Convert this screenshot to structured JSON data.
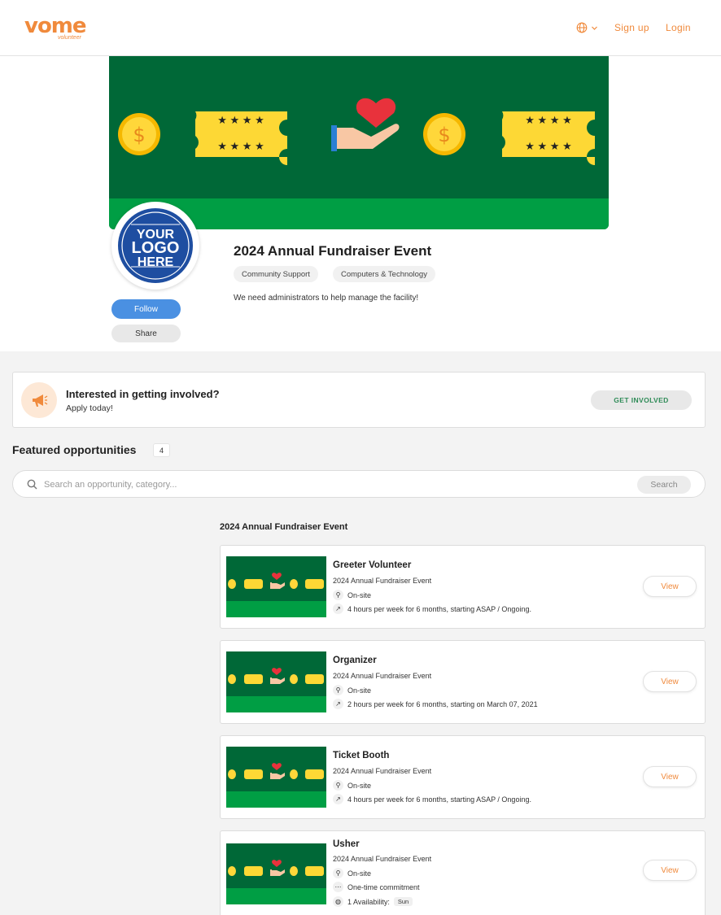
{
  "header": {
    "logo_text": "vome",
    "logo_subtext": "volunteer",
    "signup_label": "Sign up",
    "login_label": "Login"
  },
  "profile": {
    "event_title": "2024 Annual Fundraiser Event",
    "tags": [
      "Community Support",
      "Computers & Technology"
    ],
    "description": "We need administrators to help manage the facility!",
    "logo_lines": [
      "YOUR",
      "LOGO",
      "HERE"
    ],
    "follow_label": "Follow",
    "share_label": "Share"
  },
  "cta": {
    "title": "Interested in getting involved?",
    "subtitle": "Apply today!",
    "button_label": "GET INVOLVED"
  },
  "featured": {
    "title": "Featured opportunities",
    "count": "4"
  },
  "search": {
    "placeholder": "Search an opportunity, category...",
    "button_label": "Search"
  },
  "group_title": "2024 Annual Fundraiser Event",
  "opportunities": [
    {
      "title": "Greeter Volunteer",
      "org": "2024 Annual Fundraiser Event",
      "location": "On-site",
      "schedule": "4 hours per week for 6 months, starting ASAP / Ongoing.",
      "view_label": "View"
    },
    {
      "title": "Organizer",
      "org": "2024 Annual Fundraiser Event",
      "location": "On-site",
      "schedule": "2 hours per week for 6 months, starting on March 07, 2021",
      "view_label": "View"
    },
    {
      "title": "Ticket Booth",
      "org": "2024 Annual Fundraiser Event",
      "location": "On-site",
      "schedule": "4 hours per week for 6 months, starting ASAP / Ongoing.",
      "view_label": "View"
    },
    {
      "title": "Usher",
      "org": "2024 Annual Fundraiser Event",
      "location": "On-site",
      "schedule": "One-time commitment",
      "availability": "1 Availability:",
      "availability_day": "Sun",
      "view_label": "View"
    }
  ],
  "colors": {
    "brand_orange": "#f08a3c",
    "banner_dark_green": "#006837",
    "banner_light_green": "#009e44",
    "follow_blue": "#4a90e2",
    "cta_green_text": "#2e8b57"
  },
  "icons": [
    "globe-icon",
    "chevron-down-icon",
    "megaphone-icon",
    "search-icon",
    "location-pin-icon",
    "trend-icon",
    "more-icon",
    "calendar-globe-icon",
    "heart-hand-icon",
    "coin-icon",
    "ticket-icon"
  ]
}
